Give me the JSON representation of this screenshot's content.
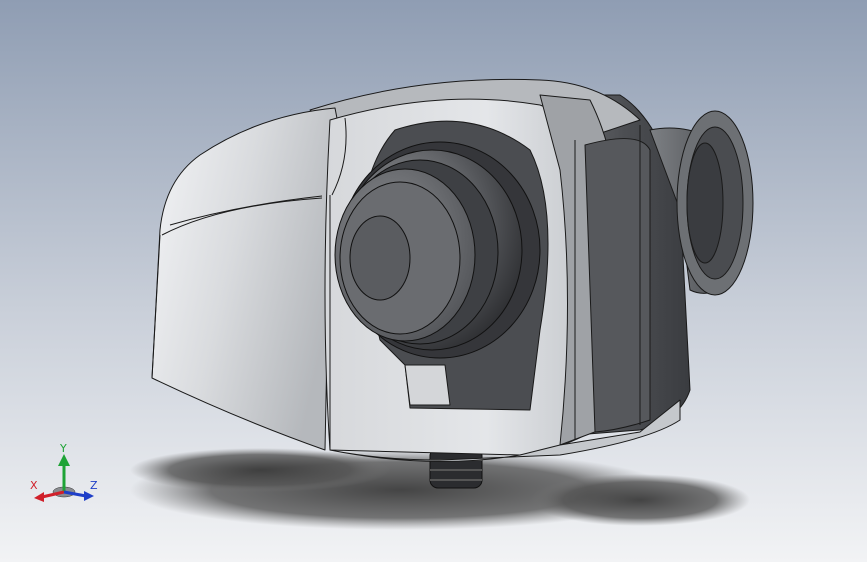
{
  "viewport": {
    "background_top": "#8f9db3",
    "background_bottom": "#f2f3f5"
  },
  "model": {
    "body_light": "#e6e8eb",
    "body_mid": "#b9bcc1",
    "body_dark": "#4a4c50",
    "edge_color": "#1a1a1a",
    "shadow_color": "#4a4a4a"
  },
  "triad": {
    "x_label": "X",
    "y_label": "Y",
    "z_label": "Z",
    "x_color": "#d0202a",
    "y_color": "#1ea336",
    "z_color": "#1f3fc8"
  }
}
